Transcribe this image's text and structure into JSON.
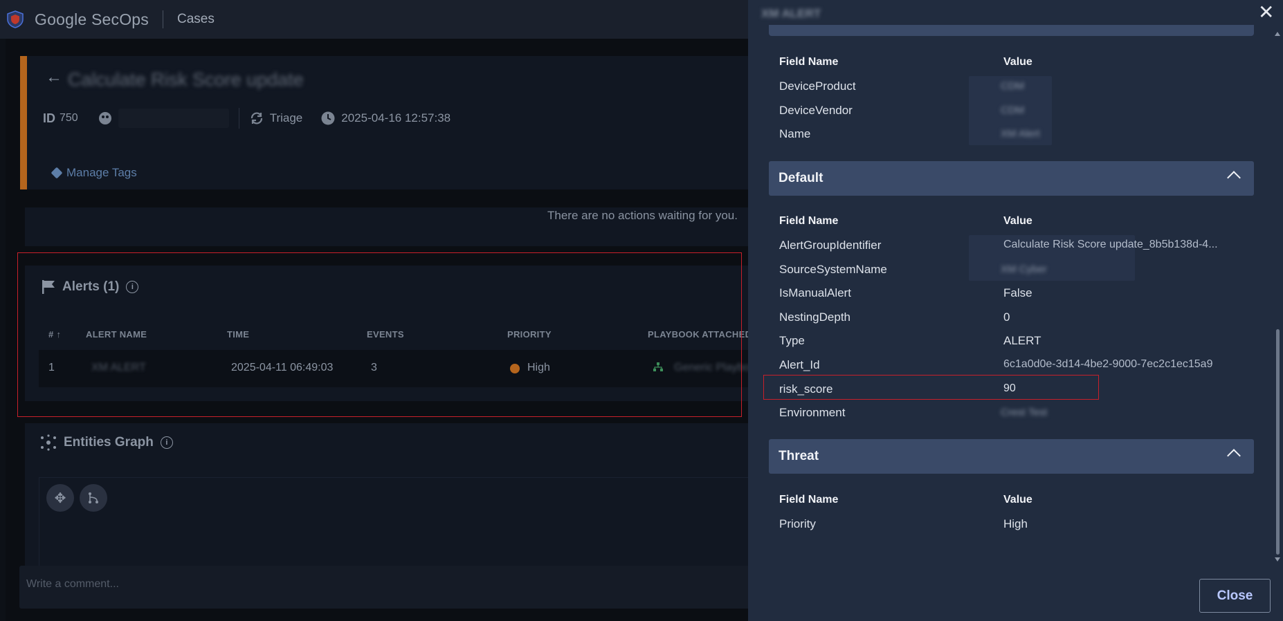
{
  "topbar": {
    "brand": "Google SecOps",
    "crumb": "Cases"
  },
  "case": {
    "title": "Calculate Risk Score update",
    "id_label": "ID",
    "id_value": "750",
    "stage": "Triage",
    "timestamp": "2025-04-16 12:57:38",
    "manage_tags": "Manage Tags",
    "no_actions": "There are no actions waiting for you."
  },
  "alerts": {
    "title": "Alerts (1)",
    "columns": [
      "# ↑",
      "ALERT NAME",
      "TIME",
      "EVENTS",
      "PRIORITY",
      "PLAYBOOK ATTACHED"
    ],
    "rows": [
      {
        "num": "1",
        "name": "XM ALERT",
        "time": "2025-04-11 06:49:03",
        "events": "3",
        "priority": "High",
        "playbook": "Generic Playbook"
      }
    ],
    "priority_color": "#b5651d"
  },
  "graph": {
    "title": "Entities Graph"
  },
  "comment": {
    "placeholder": "Write a comment..."
  },
  "panel": {
    "title": "XM ALERT",
    "field_name_header": "Field Name",
    "value_header": "Value",
    "top_rows": [
      {
        "field": "DeviceProduct",
        "value": "CDM"
      },
      {
        "field": "DeviceVendor",
        "value": "CDM"
      },
      {
        "field": "Name",
        "value": "XM Alert"
      }
    ],
    "sections": {
      "default": {
        "title": "Default",
        "rows": [
          {
            "field": "AlertGroupIdentifier",
            "value": "Calculate Risk Score update_8b5b138d-4..."
          },
          {
            "field": "SourceSystemName",
            "value": "XM Cyber"
          },
          {
            "field": "IsManualAlert",
            "value": "False"
          },
          {
            "field": "NestingDepth",
            "value": "0"
          },
          {
            "field": "Type",
            "value": "ALERT"
          },
          {
            "field": "Alert_Id",
            "value": "6c1a0d0e-3d14-4be2-9000-7ec2c1ec15a9"
          },
          {
            "field": "risk_score",
            "value": "90"
          },
          {
            "field": "Environment",
            "value": "Crest Test"
          }
        ]
      },
      "threat": {
        "title": "Threat",
        "rows": [
          {
            "field": "Priority",
            "value": "High"
          }
        ]
      }
    },
    "close_label": "Close",
    "accent": "#3a4a68",
    "highlight_color": "#c8202a"
  }
}
